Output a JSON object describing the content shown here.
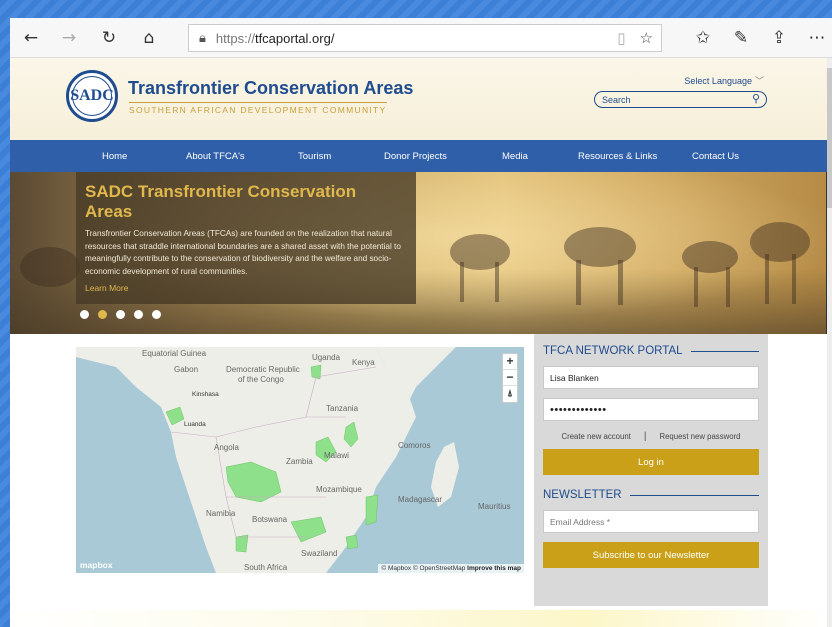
{
  "browser": {
    "url_scheme": "https://",
    "url_host": "tfcaportal.org/"
  },
  "header": {
    "title": "Transfrontier Conservation Areas",
    "subtitle": "SOUTHERN AFRICAN DEVELOPMENT COMMUNITY",
    "logo_text": "SADC",
    "language": "Select Language",
    "search_placeholder": "Search"
  },
  "nav": [
    {
      "label": "Home"
    },
    {
      "label": "About TFCA's"
    },
    {
      "label": "Tourism"
    },
    {
      "label": "Donor Projects"
    },
    {
      "label": "Media"
    },
    {
      "label": "Resources & Links"
    },
    {
      "label": "Contact Us"
    }
  ],
  "hero": {
    "title": "SADC Transfrontier Conservation Areas",
    "text": "Transfrontier Conservation Areas (TFCAs) are founded on the realization that natural resources that straddle international boundaries are a shared asset with the potential to meaningfully contribute to the conservation of biodiversity and the welfare and socio-economic development of rural communities.",
    "link": "Learn More",
    "slide_count": 5,
    "active_slide": 2
  },
  "map": {
    "labels": [
      {
        "text": "Equatorial Guinea"
      },
      {
        "text": "Gabon"
      },
      {
        "text": "Democratic Republic"
      },
      {
        "text": "of the Congo"
      },
      {
        "text": "Uganda"
      },
      {
        "text": "Kenya"
      },
      {
        "text": "Kinshasa"
      },
      {
        "text": "Tanzania"
      },
      {
        "text": "Luanda"
      },
      {
        "text": "Angola"
      },
      {
        "text": "Malawi"
      },
      {
        "text": "Comoros"
      },
      {
        "text": "Zambia"
      },
      {
        "text": "Mozambique"
      },
      {
        "text": "Madagascar"
      },
      {
        "text": "Mauritius"
      },
      {
        "text": "Namibia"
      },
      {
        "text": "Botswana"
      },
      {
        "text": "Swaziland"
      },
      {
        "text": "South Africa"
      }
    ],
    "zoom_in": "+",
    "zoom_out": "−",
    "compass": "⍋",
    "attribution_prefix": "© Mapbox © OpenStreetMap",
    "attribution_link": "Improve this map",
    "logo": "mapbox"
  },
  "portal": {
    "heading": "TFCA NETWORK PORTAL",
    "username": "Lisa Blanken",
    "password": "•••••••••••••",
    "create_account": "Create new account",
    "separator": "|",
    "request_password": "Request new password",
    "login": "Log in"
  },
  "newsletter": {
    "heading": "NEWSLETTER",
    "email_placeholder": "Email Address *",
    "subscribe": "Subscribe to our Newsletter"
  },
  "colors": {
    "nav_blue": "#2e5fa8",
    "gold": "#c9a017",
    "title_blue": "#1f4b8f",
    "tfca_green": "#8fe08a"
  }
}
